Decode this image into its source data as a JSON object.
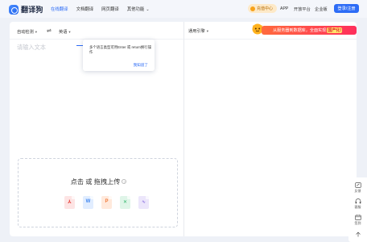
{
  "app": {
    "name": "翻译狗"
  },
  "nav": {
    "items": [
      {
        "label": "在线翻译",
        "active": true
      },
      {
        "label": "文档翻译",
        "active": false
      },
      {
        "label": "网页翻译",
        "active": false
      },
      {
        "label": "其他功能",
        "active": false
      }
    ]
  },
  "header_right": {
    "vip": "充值中心",
    "app": "APP",
    "open": "开放平台",
    "enterprise": "企业版",
    "login": "登录/注册"
  },
  "source": {
    "lang": "自动检测",
    "target_lang": "英语",
    "placeholder": "请输入文本"
  },
  "tooltip": {
    "text": "多个语言类型可用Enter 或 return换行操作",
    "button": "我知道了"
  },
  "upload": {
    "title": "点击 或 拖拽上传",
    "file_types": [
      "pdf",
      "word",
      "ppt",
      "excel",
      "image"
    ]
  },
  "target": {
    "engine": "通用引擎",
    "banner_text": "从服务器到数据库，全面实现",
    "banner_highlight": "国产化!"
  },
  "sidebar": {
    "feedback": "反馈",
    "service": "客服",
    "signin": "签到"
  },
  "colors": {
    "accent": "#2d6cf6",
    "banner": "#ff3b57",
    "vip": "#f7a21b"
  }
}
